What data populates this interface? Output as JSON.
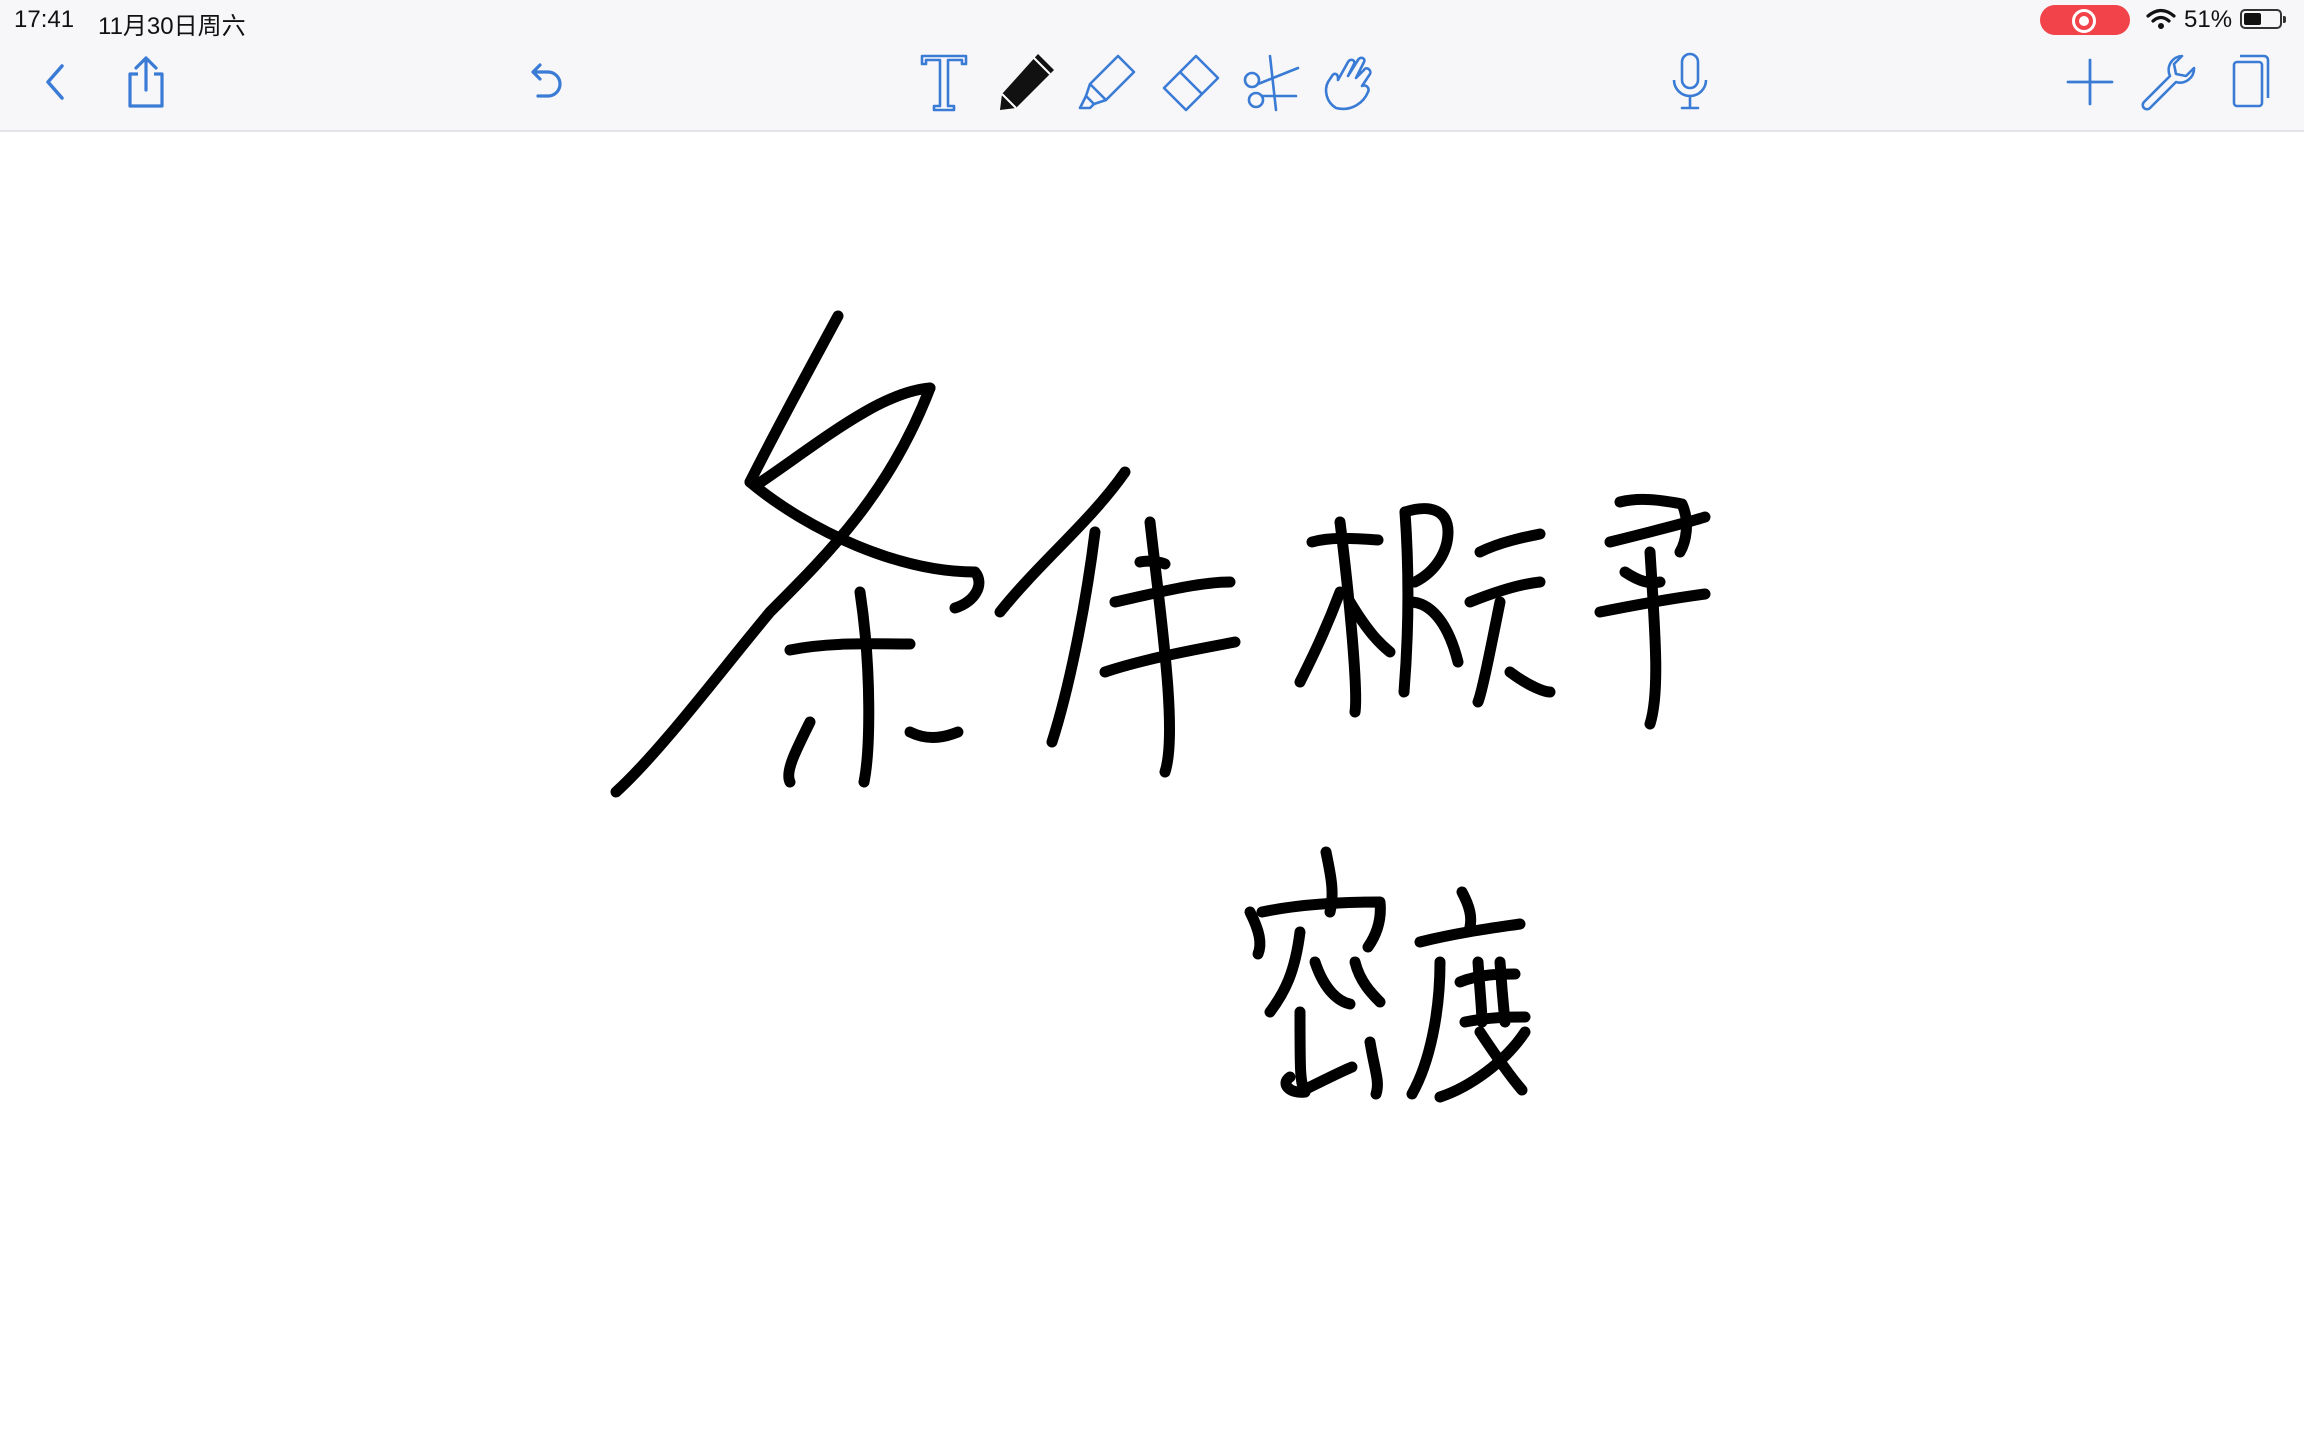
{
  "status_bar": {
    "time": "17:41",
    "date": "11月30日周六",
    "battery_percent": "51%",
    "battery_level": 0.51,
    "recording_color": "#f2434a"
  },
  "toolbar": {
    "left": [
      {
        "name": "back-button",
        "icon": "chevron-left-icon"
      },
      {
        "name": "share-button",
        "icon": "share-icon"
      },
      {
        "name": "undo-button",
        "icon": "undo-icon"
      }
    ],
    "tools": [
      {
        "name": "text-tool-button",
        "icon": "text-icon"
      },
      {
        "name": "pen-tool-button",
        "icon": "pen-icon",
        "selected": true
      },
      {
        "name": "highlighter-tool-button",
        "icon": "highlighter-icon"
      },
      {
        "name": "eraser-tool-button",
        "icon": "eraser-icon"
      },
      {
        "name": "scissors-tool-button",
        "icon": "scissors-icon"
      },
      {
        "name": "hand-tool-button",
        "icon": "hand-icon"
      }
    ],
    "right": [
      {
        "name": "microphone-button",
        "icon": "microphone-icon"
      },
      {
        "name": "add-button",
        "icon": "plus-icon"
      },
      {
        "name": "tools-button",
        "icon": "wrench-icon"
      },
      {
        "name": "pages-button",
        "icon": "pages-icon"
      }
    ],
    "accent_color": "#3a7bd5"
  },
  "canvas": {
    "ink_color": "#000000",
    "handwriting": [
      "条件概率",
      "密度"
    ]
  }
}
